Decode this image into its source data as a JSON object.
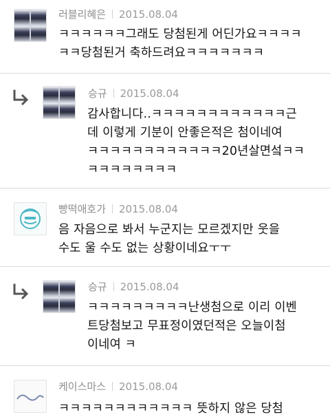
{
  "comments": [
    {
      "author": "러블리혜은",
      "date": "2015.08.04",
      "lines": [
        "ㅋㅋㅋㅋㅋㅋ그래도 당첨된게 어딘가요ㅋㅋㅋㅋ",
        "ㅋㅋ당첨된거 축하드려요ㅋㅋㅋㅋㅋㅋㅋ"
      ],
      "reply": false
    },
    {
      "author": "승규",
      "date": "2015.08.04",
      "lines": [
        "감사합니다..ㅋㅋㅋㅋㅋㅋㅋㅋㅋㅋㅋㅋ근",
        "데 이렇게 기분이 안좋은적은 첨이네여",
        "ㅋㅋㅋㅋㅋㅋㅋㅋㅋㅋㅋㅋ20년살면섴ㅋㅋ",
        "ㅋㅋㅋㅋㅋㅋㅋㅋ"
      ],
      "reply": true
    },
    {
      "author": "빵떡애호가",
      "date": "2015.08.04",
      "lines": [
        "음 자음으로 봐서 누군지는 모르겠지만 웃을",
        "수도 울 수도 없는 상황이네요ㅜㅜ"
      ],
      "reply": false
    },
    {
      "author": "승규",
      "date": "2015.08.04",
      "lines": [
        "ㅋㅋㅋㅋㅋㅋㅋㅋㅋ난생첨으로 이리 이벤",
        "트당첨보고 무표정이였던적은 오늘이첨",
        "이네여 ㅋ"
      ],
      "reply": true
    },
    {
      "author": "케이스마스",
      "date": "2015.08.04",
      "lines": [
        "ㅋㅋㅋㅋㅋㅋㅋㅋㅋㅋㅋㅋ 뜻하지 않은 당첨"
      ],
      "reply": false
    }
  ],
  "avatars": {
    "reply_arrow_icon": "reply-arrow",
    "badge_color": "#4fb8c4"
  }
}
